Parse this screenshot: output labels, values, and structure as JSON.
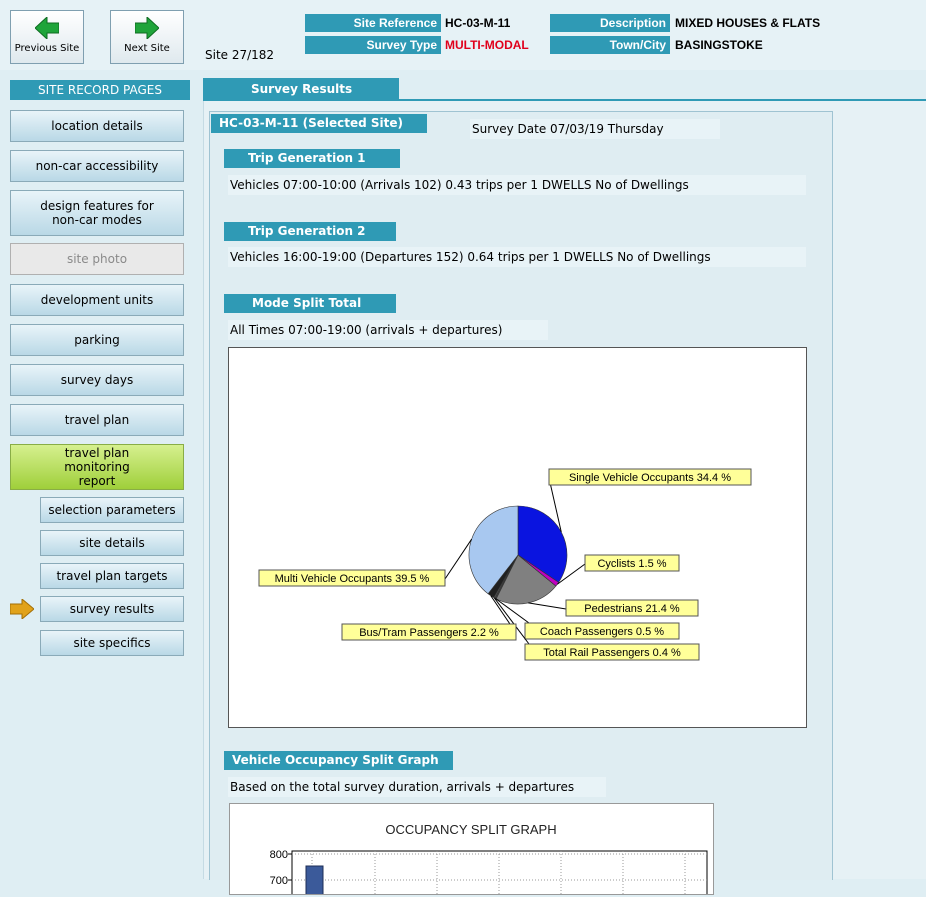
{
  "nav": {
    "prev_label": "Previous Site",
    "next_label": "Next Site",
    "site_count": "Site 27/182"
  },
  "header": {
    "site_reference_label": "Site Reference",
    "site_reference": "HC-03-M-11",
    "survey_type_label": "Survey Type",
    "survey_type": "MULTI-MODAL",
    "description_label": "Description",
    "description": "MIXED HOUSES & FLATS",
    "town_label": "Town/City",
    "town": "BASINGSTOKE"
  },
  "sidebar": {
    "heading": "SITE RECORD PAGES",
    "items": [
      "location details",
      "non-car accessibility",
      "design features for non-car modes",
      "site photo",
      "development units",
      "parking",
      "survey days",
      "travel plan",
      "travel plan monitoring report"
    ],
    "subitems": [
      "selection parameters",
      "site details",
      "travel plan targets",
      "survey results",
      "site specifics"
    ]
  },
  "main": {
    "tab": "Survey Results",
    "selected_site": "HC-03-M-11 (Selected Site)",
    "survey_date": "Survey Date 07/03/19 Thursday",
    "trip1_head": "Trip Generation 1",
    "trip1_text": "Vehicles 07:00-10:00 (Arrivals 102) 0.43 trips per 1 DWELLS No of Dwellings",
    "trip2_head": "Trip Generation 2",
    "trip2_text": "Vehicles 16:00-19:00 (Departures 152) 0.64 trips per 1 DWELLS No of Dwellings",
    "mode_head": "Mode Split Total",
    "mode_text": "All Times 07:00-19:00 (arrivals + departures)",
    "occ_head": "Vehicle Occupancy Split Graph",
    "occ_text": "Based on the total survey duration, arrivals + departures"
  },
  "chart_data": [
    {
      "type": "pie",
      "title": "",
      "slices": [
        {
          "label": "Single Vehicle Occupants",
          "value": 34.4,
          "text": "Single Vehicle Occupants 34.4 %",
          "color": "#0a14e0"
        },
        {
          "label": "Cyclists",
          "value": 1.5,
          "text": "Cyclists 1.5 %",
          "color": "#c000c0"
        },
        {
          "label": "Pedestrians",
          "value": 21.4,
          "text": "Pedestrians 21.4 %",
          "color": "#808080"
        },
        {
          "label": "Coach Passengers",
          "value": 0.5,
          "text": "Coach Passengers 0.5 %",
          "color": "#404040"
        },
        {
          "label": "Total Rail Passengers",
          "value": 0.4,
          "text": "Total Rail Passengers 0.4 %",
          "color": "#606060"
        },
        {
          "label": "Bus/Tram Passengers",
          "value": 2.2,
          "text": "Bus/Tram Passengers 2.2 %",
          "color": "#202020"
        },
        {
          "label": "Multi Vehicle Occupants",
          "value": 39.5,
          "text": "Multi Vehicle Occupants 39.5 %",
          "color": "#a8c8f0"
        }
      ]
    },
    {
      "type": "bar",
      "title": "OCCUPANCY SPLIT GRAPH",
      "yticks": [
        "800",
        "700"
      ],
      "ylim": [
        0,
        800
      ]
    }
  ]
}
